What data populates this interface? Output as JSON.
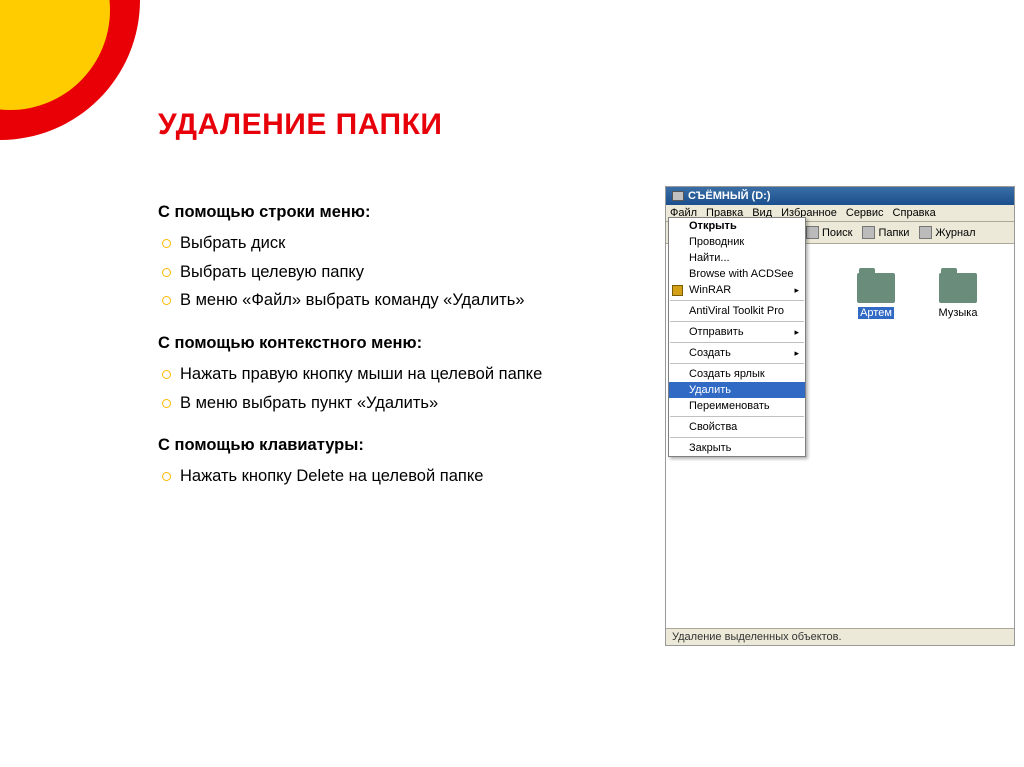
{
  "title": "УДАЛЕНИЕ ПАПКИ",
  "sections": [
    {
      "head": "С помощью строки меню:",
      "items": [
        "Выбрать диск",
        "Выбрать целевую папку",
        "В меню «Файл» выбрать команду «Удалить»"
      ]
    },
    {
      "head": "С помощью контекстного меню:",
      "items": [
        "Нажать правую кнопку мыши на целевой папке",
        "В меню выбрать пункт «Удалить»"
      ]
    },
    {
      "head": "С помощью клавиатуры:",
      "items": [
        "Нажать кнопку Delete на целевой папке"
      ]
    }
  ],
  "window": {
    "title": "СЪЁМНЫЙ (D:)",
    "menubar": [
      "Файл",
      "Правка",
      "Вид",
      "Избранное",
      "Сервис",
      "Справка"
    ],
    "toolbar": {
      "search": "Поиск",
      "folders": "Папки",
      "journal": "Журнал"
    },
    "context_menu": {
      "open": "Открыть",
      "explorer": "Проводник",
      "find": "Найти...",
      "acdsee": "Browse with ACDSee",
      "winrar": "WinRAR",
      "avp": "AntiViral Toolkit Pro",
      "send": "Отправить",
      "create": "Создать",
      "shortcut": "Создать ярлык",
      "delete": "Удалить",
      "rename": "Переименовать",
      "props": "Свойства",
      "close": "Закрыть"
    },
    "folders": {
      "artem": "Артем",
      "music": "Музыка"
    },
    "status": "Удаление выделенных объектов."
  }
}
